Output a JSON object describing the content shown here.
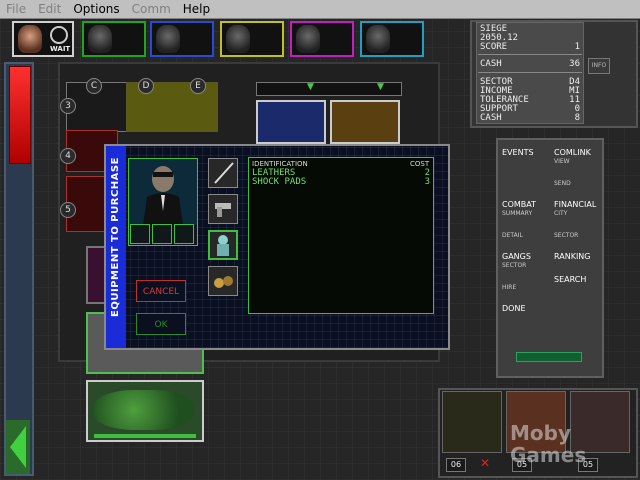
{
  "menu": {
    "items": [
      {
        "label": "File",
        "enabled": false
      },
      {
        "label": "Edit",
        "enabled": false
      },
      {
        "label": "Options",
        "enabled": true
      },
      {
        "label": "Comm",
        "enabled": false
      },
      {
        "label": "Help",
        "enabled": true
      }
    ]
  },
  "portraits": {
    "wait_label": "WAIT",
    "border_colors": [
      "#d0d0d0",
      "#1ea51e",
      "#2a4ad0",
      "#c0c020",
      "#c020c0",
      "#20a0c0"
    ]
  },
  "map": {
    "column_labels": [
      "C",
      "D",
      "E"
    ],
    "row_labels": [
      "3",
      "4",
      "5"
    ]
  },
  "dialog": {
    "title": "EQUIPMENT TO PURCHASE",
    "cancel_label": "CANCEL",
    "ok_label": "OK",
    "list_header_id": "IDENTIFICATION",
    "list_header_cost": "COST",
    "items": [
      {
        "name": "LEATHERS",
        "cost": "2"
      },
      {
        "name": "SHOCK PADS",
        "cost": "3"
      }
    ],
    "item_icons": [
      "blade-icon",
      "pistol-icon",
      "armor-icon",
      "goggles-icon"
    ]
  },
  "info": {
    "line1": "SIEGE",
    "line2": "2050.12",
    "score_label": "SCORE",
    "score": "1",
    "cash_label": "CASH",
    "cash": "36",
    "sector_label": "SECTOR",
    "sector": "D4",
    "income_label": "INCOME",
    "income": "MI",
    "tolerance_label": "TOLERANCE",
    "tolerance": "11",
    "support_label": "SUPPORT",
    "support": "0",
    "cash2_label": "CASH",
    "cash2": "8",
    "info_button": "INFO"
  },
  "right_menu": {
    "events": "EVENTS",
    "comlink": "COMLINK",
    "view": "VIEW",
    "send": "SEND",
    "combat": "COMBAT",
    "summary": "SUMMARY",
    "financial": "FINANCIAL",
    "city": "CITY",
    "detail": "DETAIL",
    "sector": "SECTOR",
    "gangs": "GANGS",
    "gangs_sector": "SECTOR",
    "ranking": "RANKING",
    "hire": "HIRE",
    "search": "SEARCH",
    "done": "DONE"
  },
  "squad": {
    "numbers": [
      "06",
      "05",
      "05"
    ],
    "watermark_line1": "Moby",
    "watermark_line2": "Games"
  },
  "colors": {
    "dialog_accent": "#1a2bd8",
    "list_text": "#6fe06f",
    "cancel": "#e03838"
  }
}
